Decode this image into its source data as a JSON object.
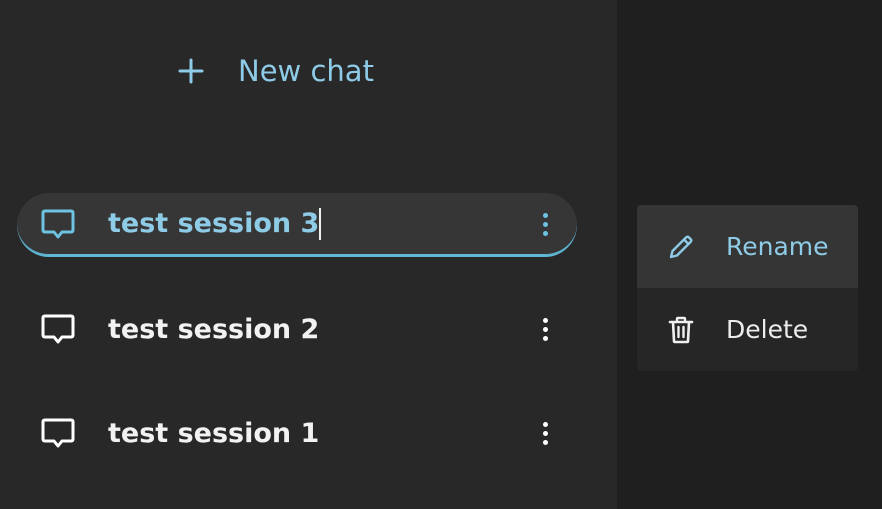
{
  "sidebar": {
    "new_chat": {
      "label": "New chat",
      "icon": "plus-icon"
    },
    "sessions": [
      {
        "label": "test session 3",
        "icon": "chat-bubble-icon",
        "menu_icon": "kebab-menu-icon",
        "active": true,
        "editing": true
      },
      {
        "label": "test session 2",
        "icon": "chat-bubble-icon",
        "menu_icon": "kebab-menu-icon",
        "active": false
      },
      {
        "label": "test session 1",
        "icon": "chat-bubble-icon",
        "menu_icon": "kebab-menu-icon",
        "active": false
      }
    ]
  },
  "context_menu": {
    "items": [
      {
        "label": "Rename",
        "icon": "pencil-icon",
        "hovered": true
      },
      {
        "label": "Delete",
        "icon": "trash-icon",
        "hovered": false
      }
    ]
  },
  "colors": {
    "accent": "#8ecbe6",
    "sidebar_bg": "#282828",
    "main_bg": "#1f1f1f",
    "active_item_bg": "#363636",
    "menu_bg": "#262626",
    "menu_hover_bg": "#353535",
    "text": "#f2f2f2"
  }
}
